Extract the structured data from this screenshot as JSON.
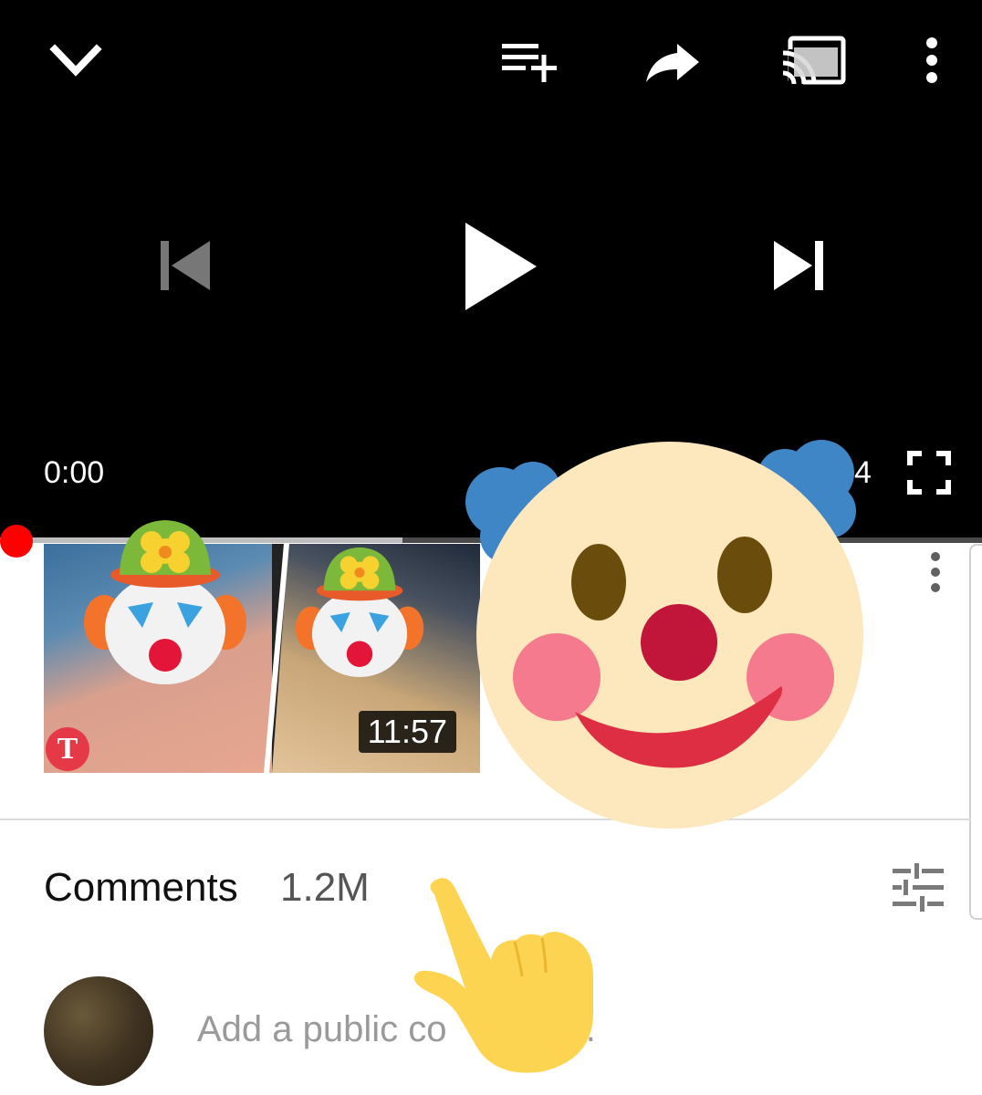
{
  "player": {
    "current_time": "0:00",
    "duration_partial": "4",
    "buffered_fraction": 0.41,
    "played_fraction": 0.0,
    "icons": {
      "minimize": "chevron-down-icon",
      "add_to_queue": "playlist-add-icon",
      "share": "share-icon",
      "cast": "cast-icon",
      "menu": "more-vert-icon",
      "previous": "skip-previous-icon",
      "play": "play-icon",
      "next": "skip-next-icon",
      "fullscreen": "fullscreen-icon"
    }
  },
  "video_card": {
    "duration": "11:57",
    "channel_badge": "T"
  },
  "comments": {
    "title": "Comments",
    "count": "1.2M",
    "input_placeholder": "Add a public co",
    "input_trailing": "..."
  },
  "colors": {
    "progress_red": "#ff0000",
    "player_bg": "#000000",
    "clown_face": "#fde7bd",
    "clown_hair": "#3f86c6",
    "clown_nose": "#c1163a",
    "pointer_hand": "#fdd451"
  },
  "stickers": [
    "clown-face-emoji",
    "clown-face-emoji",
    "clown-face-emoji",
    "pointing-down-hand-emoji"
  ]
}
